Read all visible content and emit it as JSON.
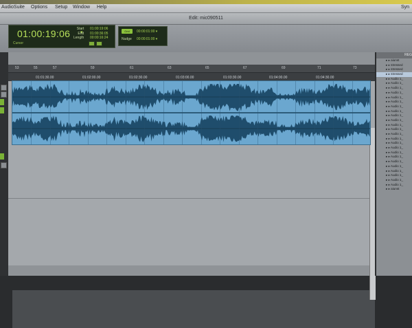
{
  "menubar": {
    "items": [
      "AudioSuite",
      "Options",
      "Setup",
      "Window",
      "Help"
    ],
    "right": "Syn"
  },
  "window": {
    "title": "Edit: mic090511"
  },
  "counter": {
    "main": "01:00:19:06",
    "caret": "▾",
    "mode_label": "Cursor",
    "start_label": "Start",
    "end_label": "End",
    "length_label": "Length",
    "start_value": "01:00:19:06",
    "end_value": "01:00:36:05",
    "length_value": "00:00:16:24"
  },
  "nudge": {
    "grid_label": "Grid",
    "grid_value": "00:00:01:00 ▾",
    "nudge_label": "Nudge",
    "nudge_value": "00:00:01:00 ▾"
  },
  "ruler": {
    "bars": [
      "53",
      "55",
      "57",
      "59",
      "61",
      "63",
      "65",
      "67",
      "69",
      "71",
      "73"
    ],
    "times": [
      "01:01:30.00",
      "01:02:00.00",
      "01:02:30.00",
      "01:03:00.00",
      "01:03:30.00",
      "01:04:00.00",
      "01:04:30.00"
    ]
  },
  "regions": {
    "header": "REG",
    "items": [
      "▸ ▸ aiunst",
      "▸ ▸ stressed",
      "▸ ▸ stressed",
      "▸ ▸ stressed",
      "▸ ▸ Audio 1_",
      "▸ ▸ Audio 1_",
      "▸ ▸ Audio 1_",
      "▸ ▸ Audio 1_",
      "▸ ▸ Audio 1_",
      "▸ ▸ Audio 1_",
      "▸ ▸ Audio 1_",
      "▸ ▸ Audio 1_",
      "▸ ▸ Audio 1_",
      "▸ ▸ Audio 1_",
      "▸ ▸ Audio 1_",
      "▸ ▸ Audio 1_",
      "▸ ▸ Audio 1_",
      "▸ ▸ Audio 1_",
      "▸ ▸ Audio 1_",
      "▸ ▸ Audio 1_",
      "▸ ▸ Audio 1_",
      "▸ ▸ Audio 1_",
      "▸ ▸ Audio 1_",
      "▸ ▸ Audio 1_",
      "▸ ▸ Audio 1_",
      "▸ ▸ Audio 1_",
      "▸ ▸ Audio 1_",
      "▸ ▸ Audio 1_",
      "▸ ▸ aiunst"
    ],
    "selected_index": 3
  },
  "colors": {
    "counter_green": "#b7e05a",
    "clip_blue": "#6ba7cf",
    "waveform": "#1f4d6c"
  }
}
